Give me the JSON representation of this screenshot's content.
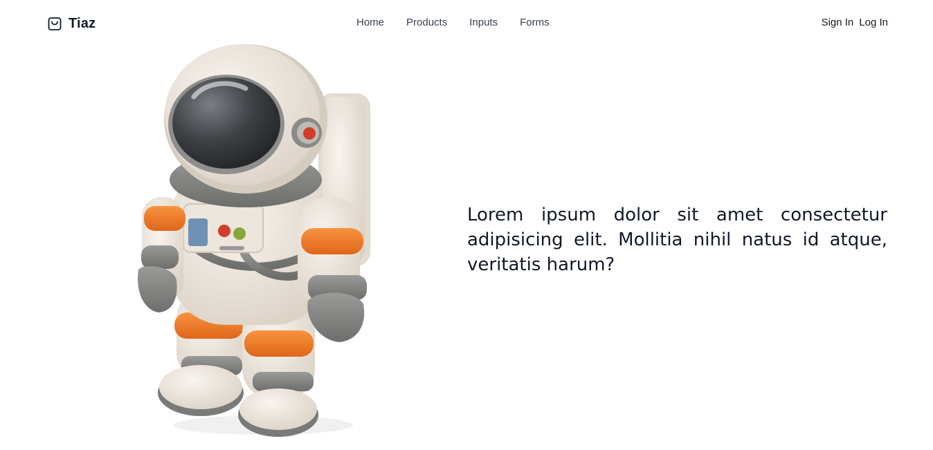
{
  "header": {
    "brand": {
      "name": "Tiaz",
      "icon": "shopping-bag-icon"
    },
    "nav": [
      {
        "label": "Home"
      },
      {
        "label": "Products"
      },
      {
        "label": "Inputs"
      },
      {
        "label": "Forms"
      }
    ],
    "auth": {
      "sign_in": "Sign In",
      "log_in": "Log In"
    }
  },
  "hero": {
    "image": {
      "subject": "astronaut-illustration"
    },
    "text": "Lorem ipsum dolor sit amet consectetur adipisicing elit. Mollitia nihil natus id atque, veritatis harum?"
  },
  "colors": {
    "text": "#111827",
    "nav_text": "#374151",
    "suit": "#ede6dc",
    "stripe": "#f07a22",
    "grey": "#8a8a88",
    "visor": "#3d4044"
  }
}
